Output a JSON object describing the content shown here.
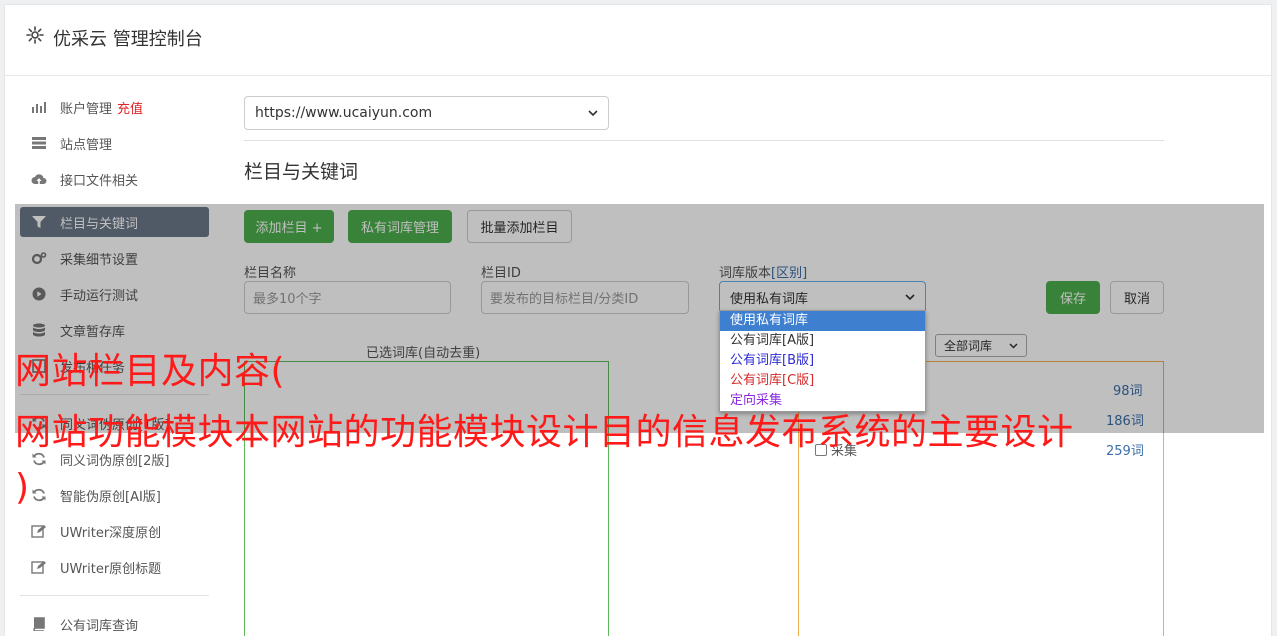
{
  "header": {
    "title": "优采云 管理控制台",
    "icon": "gear-icon"
  },
  "sidebar": {
    "items": [
      {
        "label": "账户管理",
        "extra": "充值",
        "icon": "bar-chart-icon"
      },
      {
        "label": "站点管理",
        "icon": "server-icon"
      },
      {
        "label": "接口文件相关",
        "icon": "cloud-upload-icon"
      },
      {
        "label": "栏目与关键词",
        "icon": "filter-icon",
        "active": true
      },
      {
        "label": "采集细节设置",
        "icon": "cogs-icon"
      },
      {
        "label": "手动运行测试",
        "icon": "play-circle-icon"
      },
      {
        "label": "文章暂存库",
        "icon": "database-icon"
      },
      {
        "label": "发布相任务",
        "icon": "task-icon"
      },
      {
        "label": "同义词伪原创[1版]",
        "icon": "refresh-icon"
      },
      {
        "label": "同义词伪原创[2版]",
        "icon": "refresh-icon"
      },
      {
        "label": "智能伪原创[AI版]",
        "icon": "refresh-icon"
      },
      {
        "label": "UWriter深度原创",
        "icon": "edit-icon"
      },
      {
        "label": "UWriter原创标题",
        "icon": "edit-icon"
      },
      {
        "label": "公有词库查询",
        "icon": "book-icon"
      }
    ]
  },
  "main": {
    "site_select": "https://www.ucaiyun.com",
    "section_title": "栏目与关键词",
    "buttons": {
      "add_column": "添加栏目 +",
      "private_lib": "私有词库管理",
      "batch_add": "批量添加栏目",
      "save": "保存",
      "cancel": "取消"
    },
    "form": {
      "name_label": "栏目名称",
      "name_placeholder": "最多10个字",
      "id_label": "栏目ID",
      "id_placeholder": "要发布的目标栏目/分类ID",
      "version_label": "词库版本",
      "version_link": "[区别]",
      "version_value": "使用私有词库"
    },
    "version_options": [
      {
        "label": "使用私有词库",
        "color": "#ffffff",
        "selected": true
      },
      {
        "label": "公有词库[A版]",
        "color": "#333333"
      },
      {
        "label": "公有词库[B版]",
        "color": "#2b2bd6"
      },
      {
        "label": "公有词库[C版]",
        "color": "#d62b2b"
      },
      {
        "label": "定向采集",
        "color": "#8a2be2"
      }
    ],
    "selected_lib_label": "已选词库(自动去重)",
    "lib_filter": "全部词库",
    "lib_list": [
      {
        "label": "",
        "count": "98词"
      },
      {
        "label": "",
        "count": "186词"
      },
      {
        "label": "采集",
        "count": "259词"
      }
    ]
  },
  "watermark": {
    "line1": "网站栏目及内容(",
    "line2": "网站功能模块本网站的功能模块设计目的信息发布系统的主要设计",
    "line3": ")"
  },
  "colors": {
    "accent_green": "#4cae4c",
    "active_nav": "#6b7788",
    "watermark": "#ff1a1a"
  }
}
